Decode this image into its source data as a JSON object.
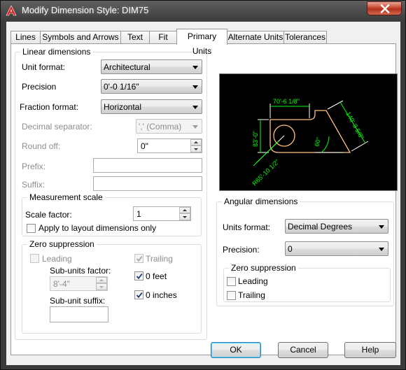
{
  "window": {
    "title": "Modify Dimension Style: DIM75"
  },
  "tabs": [
    {
      "label": "Lines"
    },
    {
      "label": "Symbols and Arrows"
    },
    {
      "label": "Text"
    },
    {
      "label": "Fit"
    },
    {
      "label": "Primary Units"
    },
    {
      "label": "Alternate Units"
    },
    {
      "label": "Tolerances"
    }
  ],
  "active_tab": "Primary Units",
  "linear": {
    "title": "Linear dimensions",
    "unit_format": {
      "label": "Unit format:",
      "value": "Architectural"
    },
    "precision": {
      "label": "Precision",
      "value": "0'-0 1/16\""
    },
    "fraction_format": {
      "label": "Fraction format:",
      "value": "Horizontal"
    },
    "decimal_separator": {
      "label": "Decimal separator:",
      "value": "',' (Comma)"
    },
    "round_off": {
      "label": "Round off:",
      "value": "0\""
    },
    "prefix": {
      "label": "Prefix:",
      "value": ""
    },
    "suffix": {
      "label": "Suffix:",
      "value": ""
    }
  },
  "measurement": {
    "title": "Measurement scale",
    "scale_factor": {
      "label": "Scale factor:",
      "value": "1"
    },
    "apply_layout": {
      "label": "Apply to layout dimensions only",
      "checked": false
    }
  },
  "zero_linear": {
    "title": "Zero suppression",
    "leading": {
      "label": "Leading",
      "checked": false,
      "disabled": true
    },
    "trailing": {
      "label": "Trailing",
      "checked": true,
      "disabled": true
    },
    "feet": {
      "label": "0 feet",
      "checked": true
    },
    "inches": {
      "label": "0 inches",
      "checked": true
    },
    "sub_units_factor": {
      "label": "Sub-units factor:",
      "value": "8'-4\""
    },
    "sub_unit_suffix": {
      "label": "Sub-unit suffix:",
      "value": ""
    }
  },
  "preview": {
    "dims": [
      "70'-6 1/8\"",
      "83'-0\"",
      "140'-3 5/8\"",
      "60°",
      "R65'-10 1/2\""
    ],
    "colors": {
      "dim": "#00ff00",
      "object": "#ffbf80",
      "line": "#ffffff"
    }
  },
  "angular": {
    "title": "Angular dimensions",
    "units_format": {
      "label": "Units format:",
      "value": "Decimal Degrees"
    },
    "precision": {
      "label": "Precision:",
      "value": "0"
    },
    "zero": {
      "title": "Zero suppression",
      "leading": {
        "label": "Leading",
        "checked": false
      },
      "trailing": {
        "label": "Trailing",
        "checked": false
      }
    }
  },
  "buttons": {
    "ok": "OK",
    "cancel": "Cancel",
    "help": "Help"
  }
}
